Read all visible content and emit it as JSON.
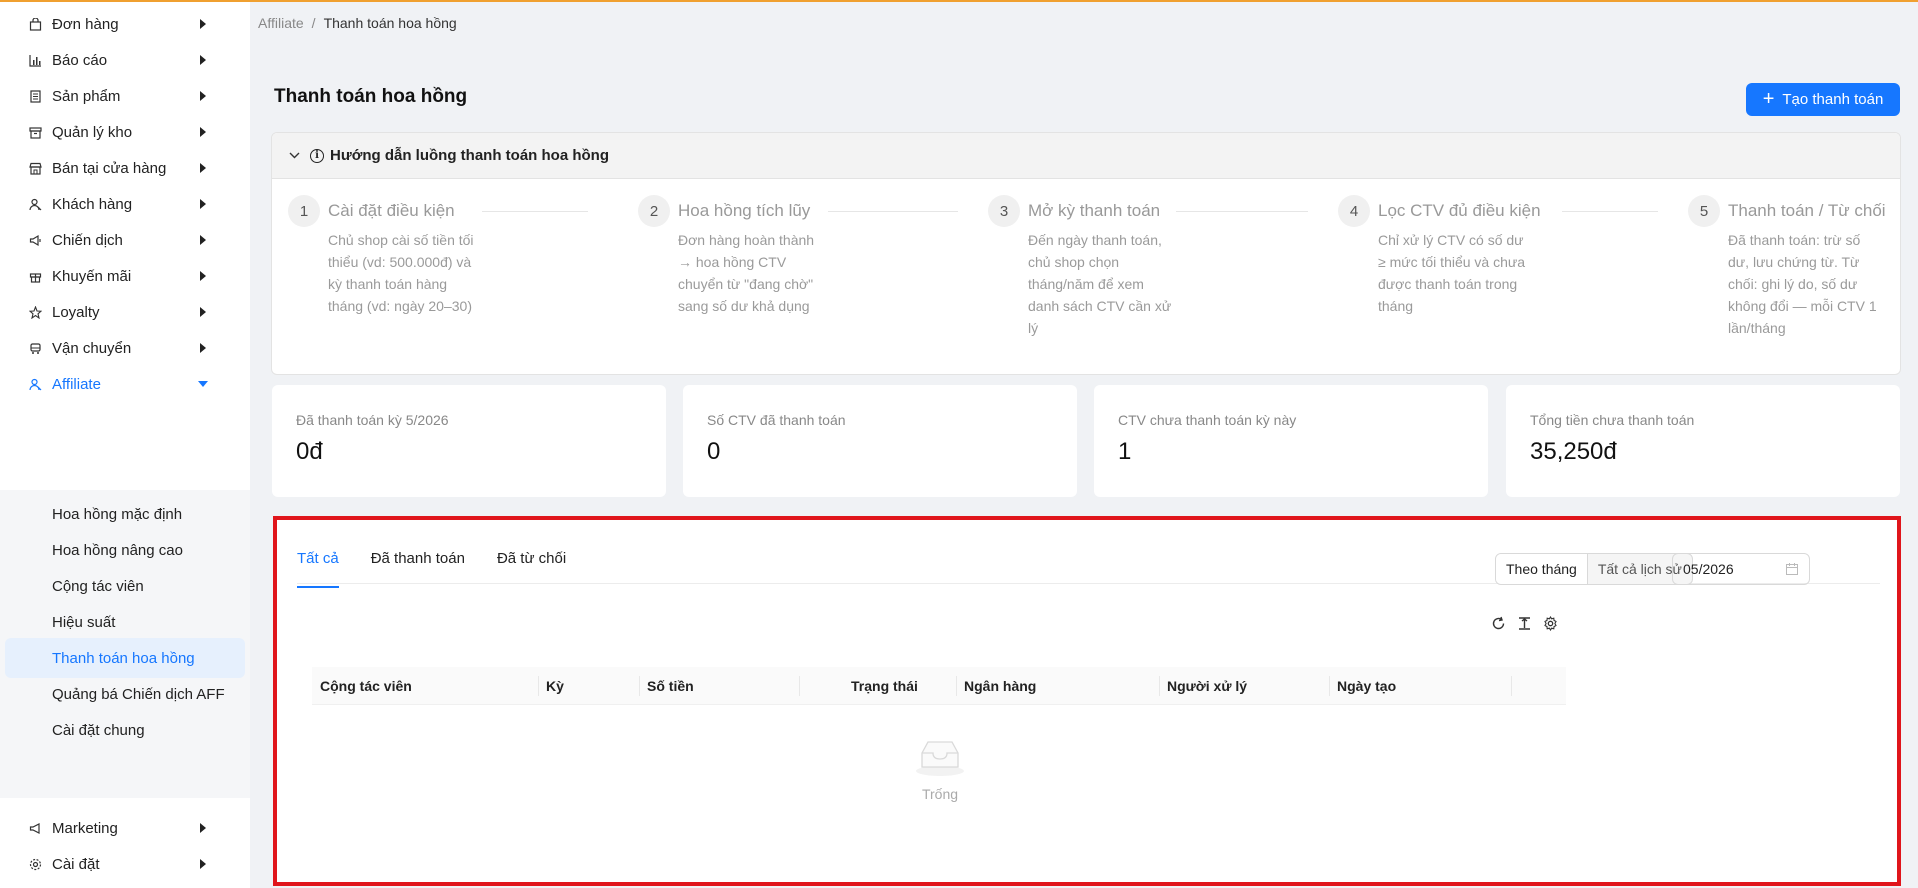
{
  "sidebar": {
    "items": [
      {
        "label": "Đơn hàng",
        "icon": "bag-icon"
      },
      {
        "label": "Báo cáo",
        "icon": "bar-chart-icon"
      },
      {
        "label": "Sản phẩm",
        "icon": "product-list-icon"
      },
      {
        "label": "Quản lý kho",
        "icon": "warehouse-icon"
      },
      {
        "label": "Bán tại cửa hàng",
        "icon": "shop-icon"
      },
      {
        "label": "Khách hàng",
        "icon": "customer-icon"
      },
      {
        "label": "Chiến dịch",
        "icon": "megaphone-icon"
      },
      {
        "label": "Khuyến mãi",
        "icon": "gift-icon"
      },
      {
        "label": "Loyalty",
        "icon": "star-icon"
      },
      {
        "label": "Vận chuyển",
        "icon": "truck-icon"
      },
      {
        "label": "Affiliate",
        "icon": "affiliate-icon"
      }
    ],
    "submenu": [
      "Hoa hồng mặc định",
      "Hoa hồng nâng cao",
      "Cộng tác viên",
      "Hiệu suất",
      "Thanh toán hoa hồng",
      "Quảng bá Chiến dịch AFF",
      "Cài đặt chung"
    ],
    "bottom": [
      {
        "label": "Marketing",
        "icon": "marketing-icon"
      },
      {
        "label": "Cài đặt",
        "icon": "gear-icon"
      }
    ]
  },
  "breadcrumb": {
    "parent": "Affiliate",
    "sep": "/",
    "current": "Thanh toán hoa hồng"
  },
  "page": {
    "title": "Thanh toán hoa hồng",
    "create_label": "Tạo thanh toán"
  },
  "guide": {
    "title": "Hướng dẫn luồng thanh toán hoa hồng",
    "steps": [
      {
        "num": "1",
        "title": "Cài đặt điều kiện",
        "desc": "Chủ shop cài số tiền tối thiểu (vd: 500.000đ) và kỳ thanh toán hàng tháng (vd: ngày 20–30)"
      },
      {
        "num": "2",
        "title": "Hoa hồng tích lũy",
        "desc": "Đơn hàng hoàn thành → hoa hồng CTV chuyển từ \"đang chờ\" sang số dư khả dụng"
      },
      {
        "num": "3",
        "title": "Mở kỳ thanh toán",
        "desc": "Đến ngày thanh toán, chủ shop chọn tháng/năm để xem danh sách CTV cần xử lý"
      },
      {
        "num": "4",
        "title": "Lọc CTV đủ điều kiện",
        "desc": "Chỉ xử lý CTV có số dư ≥ mức tối thiểu và chưa được thanh toán trong tháng"
      },
      {
        "num": "5",
        "title": "Thanh toán / Từ chối",
        "desc": "Đã thanh toán: trừ số dư, lưu chứng từ. Từ chối: ghi lý do, số dư không đổi — mỗi CTV 1 lần/tháng"
      }
    ]
  },
  "stats": [
    {
      "label": "Đã thanh toán kỳ 5/2026",
      "value": "0đ"
    },
    {
      "label": "Số CTV đã thanh toán",
      "value": "0"
    },
    {
      "label": "CTV chưa thanh toán kỳ này",
      "value": "1"
    },
    {
      "label": "Tổng tiền chưa thanh toán",
      "value": "35,250đ"
    }
  ],
  "tabs": [
    "Tất cả",
    "Đã thanh toán",
    "Đã từ chối"
  ],
  "filter": {
    "mode_month": "Theo tháng",
    "mode_all": "Tất cả lịch sử",
    "date": "05/2026"
  },
  "table": {
    "columns": [
      "Cộng tác viên",
      "Kỳ",
      "Số tiền",
      "Trạng thái",
      "Ngân hàng",
      "Người xử lý",
      "Ngày tạo"
    ],
    "empty_text": "Trống"
  },
  "colors": {
    "accent": "#1677ff",
    "highlight_border": "#e0151b",
    "top_line": "#f0a030"
  }
}
